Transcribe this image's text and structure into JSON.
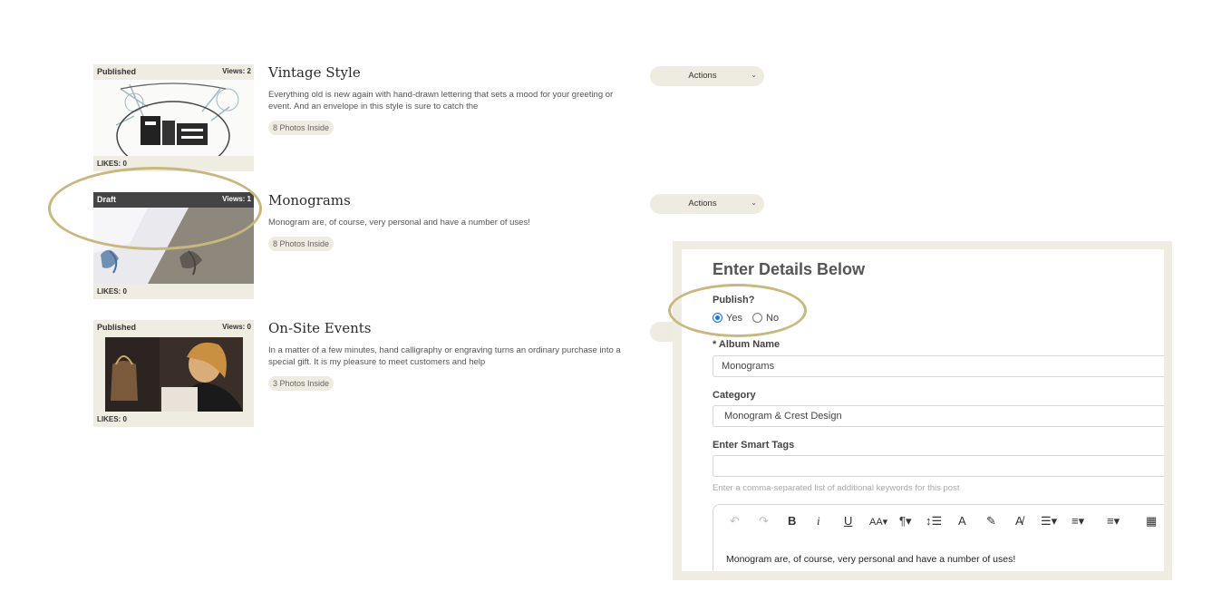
{
  "albums": [
    {
      "status": "Published",
      "views": "Views: 2",
      "likes": "LIKES: 0",
      "title": "Vintage Style",
      "description": "Everything old is new again with hand-drawn lettering that sets a mood for your greeting or event. And an envelope in this style is sure to catch the",
      "photos": "8 Photos Inside",
      "actions": "Actions"
    },
    {
      "status": "Draft",
      "views": "Views: 1",
      "likes": "LIKES: 0",
      "title": "Monograms",
      "description": "Monogram are, of course, very personal and have a number of uses!",
      "photos": "8 Photos Inside",
      "actions": "Actions"
    },
    {
      "status": "Published",
      "views": "Views: 0",
      "likes": "LIKES: 0",
      "title": "On-Site Events",
      "description": "In a matter of a few minutes, hand calligraphy or engraving turns an ordinary purchase into a special gift. It is my pleasure to meet customers and help",
      "photos": "3 Photos Inside"
    }
  ],
  "form": {
    "title": "Enter Details Below",
    "publish_label": "Publish?",
    "publish_yes": "Yes",
    "publish_no": "No",
    "publish_selected": "Yes",
    "album_name_label": "* Album Name",
    "album_name_value": "Monograms",
    "category_label": "Category",
    "category_value": "Monogram & Crest Design",
    "tags_label": "Enter Smart Tags",
    "tags_value": "",
    "tags_hint": "Enter a comma-separated list of additional keywords for this post",
    "editor_text": "Monogram are, of course, very personal and have a number of uses!"
  },
  "toolbar_icons": [
    "undo-icon",
    "redo-icon",
    "bold-icon",
    "italic-icon",
    "underline-icon",
    "font-size-icon",
    "paragraph-icon",
    "line-height-icon",
    "text-color-icon",
    "highlight-icon",
    "clear-format-icon",
    "align-icon",
    "ordered-list-icon",
    "unordered-list-icon",
    "table-icon"
  ],
  "colors": {
    "accent_ring": "#c8b87e",
    "panel_bg": "#efece1",
    "pill_bg": "#eeebe0"
  }
}
